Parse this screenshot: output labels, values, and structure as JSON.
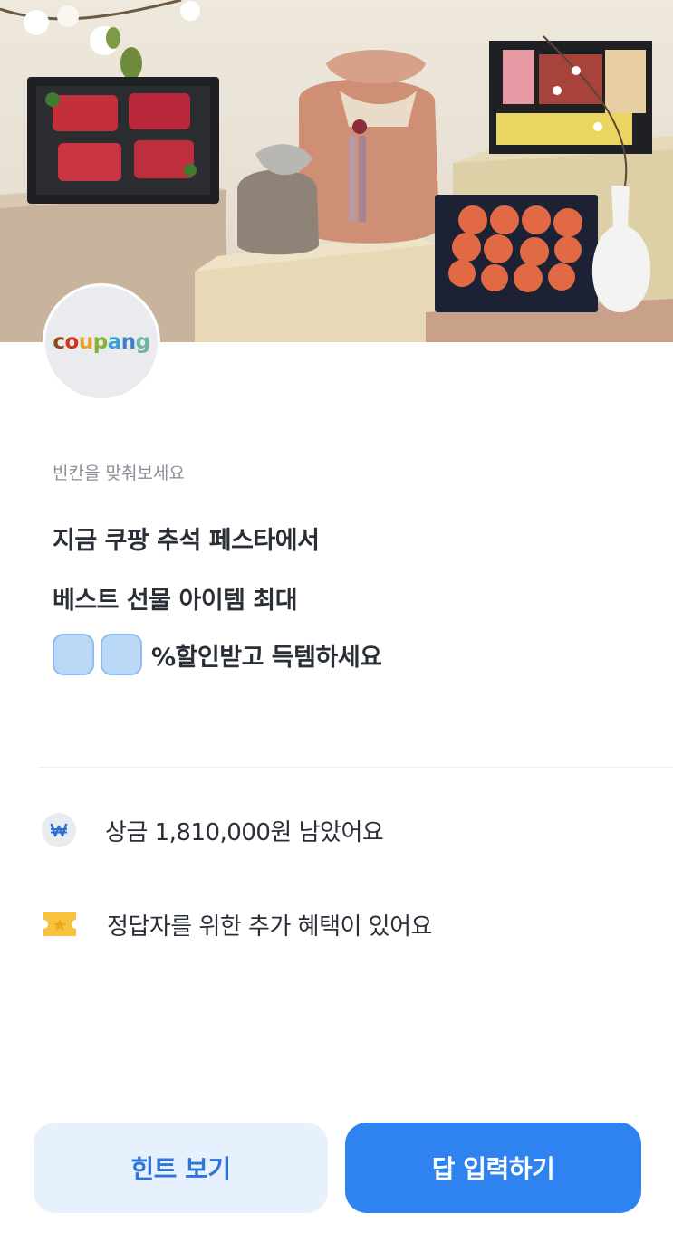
{
  "logo": {
    "letters": [
      {
        "char": "c",
        "color": "#8b4a22"
      },
      {
        "char": "o",
        "color": "#d2361f"
      },
      {
        "char": "u",
        "color": "#e8a021"
      },
      {
        "char": "p",
        "color": "#89b13a"
      },
      {
        "char": "a",
        "color": "#39a0d6"
      },
      {
        "char": "n",
        "color": "#3e7ec8"
      },
      {
        "char": "g",
        "color": "#6bb6a0"
      }
    ]
  },
  "quiz": {
    "instruction": "빈칸을 맞춰보세요",
    "line1": "지금 쿠팡 추석 페스타에서",
    "line2": "베스트 선물 아이템 최대",
    "line3_suffix": "%할인받고 득템하세요",
    "blank_count": 2,
    "blank_color": "#bcd8f7"
  },
  "info": {
    "prize": {
      "icon": "won-coin-icon",
      "text": "상금 1,810,000원 남았어요"
    },
    "bonus": {
      "icon": "ticket-icon",
      "text": "정답자를 위한 추가 혜택이 있어요"
    }
  },
  "buttons": {
    "hint_label": "힌트 보기",
    "answer_label": "답 입력하기"
  },
  "colors": {
    "primary": "#2e83f0",
    "secondary_bg": "#e7f1fd",
    "secondary_text": "#2f74d8",
    "ticket": "#f7c23c"
  }
}
